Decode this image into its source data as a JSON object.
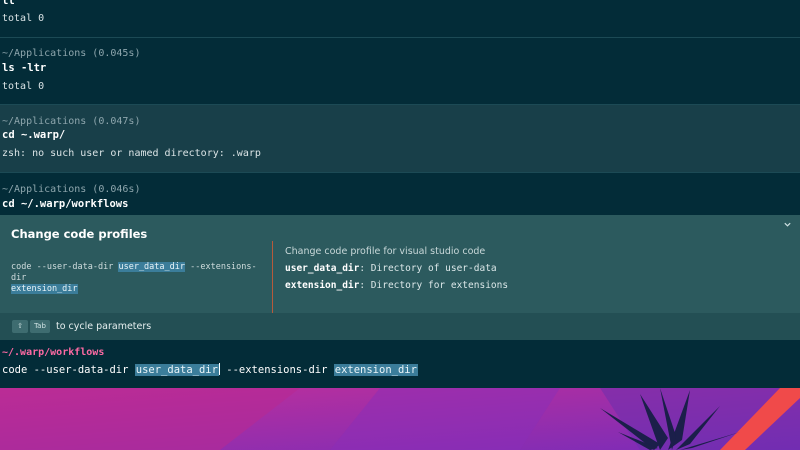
{
  "blocks": [
    {
      "command": "ll",
      "output": "total 0"
    },
    {
      "path": "~/Applications (0.045s)",
      "command": "ls -ltr",
      "output": "total 0"
    },
    {
      "path": "~/Applications (0.047s)",
      "command": "cd ~.warp/",
      "output": "zsh: no such user or named directory: .warp"
    },
    {
      "path": "~/Applications (0.046s)",
      "command": "cd ~/.warp/workflows"
    }
  ],
  "workflow_panel": {
    "title": "Change code profiles",
    "template": {
      "prefix": "code --user-data-dir ",
      "param1": "user_data_dir",
      "middle": " --extensions-dir",
      "param2": "extension_dir"
    },
    "description": "Change code profile for visual studio code",
    "params": [
      {
        "name": "user_data_dir",
        "desc": ": Directory of user-data"
      },
      {
        "name": "extension_dir",
        "desc": ": Directory for extensions"
      }
    ],
    "footer": {
      "shift_key": "⇧",
      "tab_key": "Tab",
      "hint": "to cycle parameters"
    }
  },
  "prompt": {
    "path": "~/.warp/workflows",
    "input_prefix": "code --user-data-dir ",
    "input_param1": "user_data_dir",
    "input_middle": " --extensions-dir ",
    "input_param2": "extension_dir"
  },
  "colors": {
    "terminal_bg": "#032c38",
    "panel_bg": "#2c5a5e",
    "highlight": "#3b7d9a",
    "prompt_path": "#ff6aa4",
    "divider": "#b65a3b"
  }
}
